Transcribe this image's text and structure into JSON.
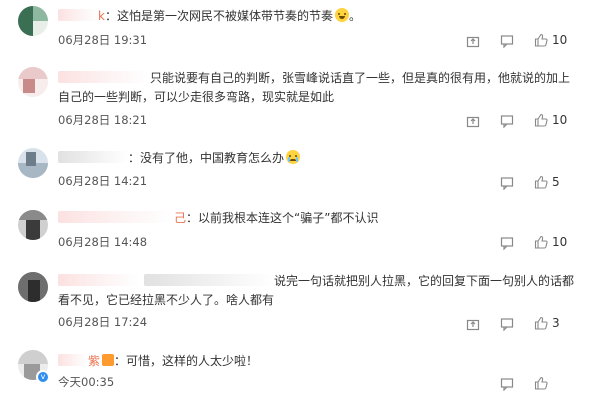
{
  "comments": [
    {
      "name_fragment": "k",
      "text": "：这怕是第一次网民不被媒体带节奏的节奏",
      "emoji": "laughing-tears",
      "trailing": "。",
      "time": "06月28日 19:31",
      "likes": "10",
      "avatar_colors": [
        "#3a6f54",
        "#8fb8a0",
        "#e8efe9"
      ]
    },
    {
      "text": "只能说要有自己的判断，张雪峰说话直了一些，但是真的很有用，他就说的加上自己的一些判断，可以少走很多弯路，现实就是如此",
      "time": "06月28日 18:21",
      "likes": "10",
      "avatar_colors": [
        "#c98a8a",
        "#e9c9c9",
        "#f7eded"
      ]
    },
    {
      "text": "：没有了他，中国教育怎么办",
      "emoji": "crying",
      "time": "06月28日 14:21",
      "likes": "5",
      "avatar_colors": [
        "#6d7d8a",
        "#a7b7c4",
        "#d9e2ea"
      ]
    },
    {
      "name_fragment": "己",
      "text": "：以前我根本连这个“骗子”都不认识",
      "time": "06月28日 14:48",
      "likes": "10",
      "avatar_colors": [
        "#3b3b3b",
        "#8a8a8a",
        "#d0d0d0"
      ]
    },
    {
      "text": "说完一句话就把别人拉黑，它的回复下面一句别人的话都看不见，它已经拉黑不少人了。啥人都有",
      "time": "06月28日 17:24",
      "likes": "3",
      "avatar_colors": [
        "#2d2d2d",
        "#6e6e6e",
        "#c4c4c4"
      ]
    },
    {
      "name_fragment": "紫",
      "text": "：可惜，这样的人太少啦！",
      "time": "今天00:35",
      "likes": "",
      "verified": true,
      "avatar_colors": [
        "#9a9a9a",
        "#cfcfcf",
        "#ececec"
      ]
    }
  ],
  "icons": {
    "share": "share-icon",
    "comment": "comment-icon",
    "like": "thumbs-up-icon",
    "verified": "verified-badge-icon"
  },
  "colors": {
    "text": "#333333",
    "time": "#555555",
    "icon": "#888888",
    "name_accent": "#eb7350",
    "verified": "#2f8ff0"
  }
}
